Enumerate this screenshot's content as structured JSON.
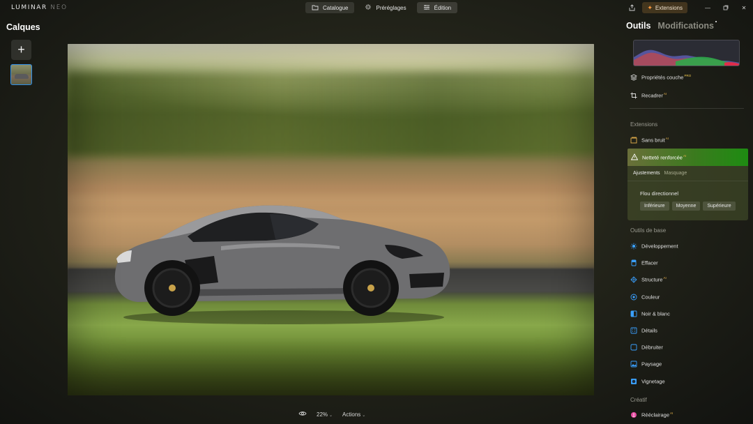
{
  "app": {
    "logo_main": "LUMINAR",
    "logo_sub": "NEO"
  },
  "nav": {
    "tabs": [
      {
        "label": "Catalogue",
        "icon": "folder-icon"
      },
      {
        "label": "Préréglages",
        "icon": "sparkle-icon"
      },
      {
        "label": "Édition",
        "icon": "sliders-icon"
      }
    ],
    "active": "Édition"
  },
  "topright": {
    "extensions_label": "Extensions"
  },
  "left": {
    "title": "Calques",
    "add_label": "+"
  },
  "bottom": {
    "zoom": "22%",
    "actions": "Actions"
  },
  "panel": {
    "tabs": {
      "tools": "Outils",
      "edits": "Modifications"
    },
    "top_tools": [
      {
        "label": "Propriétés couche",
        "badge": "PRO"
      },
      {
        "label": "Recadrer",
        "badge": "AI"
      }
    ],
    "sections": {
      "extensions": "Extensions",
      "basic": "Outils de base",
      "creative": "Créatif"
    },
    "extensions_tools": [
      {
        "label": "Sans bruit",
        "badge": "AI"
      }
    ],
    "active_tool": {
      "label": "Netteté renforcée",
      "badge": "AI",
      "subtabs": [
        "Ajustements",
        "Masquage"
      ],
      "option_title": "Flou directionnel",
      "options": [
        "Inférieure",
        "Moyenne",
        "Supérieure"
      ]
    },
    "basic_tools": [
      {
        "label": "Développement",
        "badge": ""
      },
      {
        "label": "Effacer",
        "badge": ""
      },
      {
        "label": "Structure",
        "badge": "AI"
      },
      {
        "label": "Couleur",
        "badge": ""
      },
      {
        "label": "Noir & blanc",
        "badge": ""
      },
      {
        "label": "Détails",
        "badge": ""
      },
      {
        "label": "Débruiter",
        "badge": ""
      },
      {
        "label": "Paysage",
        "badge": ""
      },
      {
        "label": "Vignetage",
        "badge": ""
      }
    ],
    "creative_tools": [
      {
        "label": "Rééclairage",
        "badge": "AI"
      }
    ]
  },
  "colors": {
    "accent_blue": "#3aa0ff",
    "extensions_orange": "#ff9a3d",
    "active_green": "#1e8c12",
    "ai_badge": "#e7b24c"
  }
}
